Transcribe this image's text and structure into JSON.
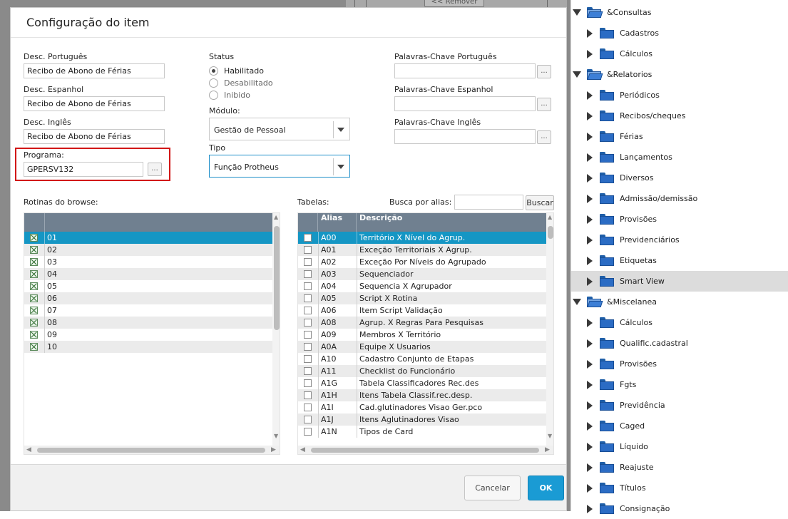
{
  "background": {
    "remover_label": "<< Remover"
  },
  "modal": {
    "title": "Configuração do item",
    "desc_pt_label": "Desc. Português",
    "desc_pt_value": "Recibo de Abono de Férias",
    "desc_es_label": "Desc. Espanhol",
    "desc_es_value": "Recibo de Abono de Férias",
    "desc_en_label": "Desc. Inglês",
    "desc_en_value": "Recibo de Abono de Férias",
    "programa_label": "Programa:",
    "programa_value": "GPERSV132",
    "dots": "...",
    "status_label": "Status",
    "status_options": [
      "Habilitado",
      "Desabilitado",
      "Inibido"
    ],
    "status_selected": "Habilitado",
    "modulo_label": "Módulo:",
    "modulo_value": "Gestão de Pessoal",
    "tipo_label": "Tipo",
    "tipo_value": "Função Protheus",
    "kw_pt_label": "Palavras-Chave Português",
    "kw_es_label": "Palavras-Chave Espanhol",
    "kw_en_label": "Palavras-Chave Inglês",
    "rotinas_label": "Rotinas do browse:",
    "tabelas_label": "Tabelas:",
    "busca_label": "Busca por alias:",
    "busca_value": "",
    "buscar_button": "Buscar",
    "cancel_button": "Cancelar",
    "ok_button": "OK"
  },
  "rotinas_grid": {
    "rows": [
      "01",
      "02",
      "03",
      "04",
      "05",
      "06",
      "07",
      "08",
      "09",
      "10"
    ]
  },
  "tabelas_grid": {
    "headers": [
      "Alias",
      "Descrição"
    ],
    "rows": [
      {
        "alias": "A00",
        "desc": "Território X Nível do Agrup."
      },
      {
        "alias": "A01",
        "desc": "Exceção Territoriais X Agrup."
      },
      {
        "alias": "A02",
        "desc": "Exceção Por Níveis do Agrupado"
      },
      {
        "alias": "A03",
        "desc": "Sequenciador"
      },
      {
        "alias": "A04",
        "desc": "Sequencia X Agrupador"
      },
      {
        "alias": "A05",
        "desc": "Script X Rotina"
      },
      {
        "alias": "A06",
        "desc": "Item Script Validação"
      },
      {
        "alias": "A08",
        "desc": "Agrup. X Regras Para Pesquisas"
      },
      {
        "alias": "A09",
        "desc": "Membros X Território"
      },
      {
        "alias": "A0A",
        "desc": "Equipe X Usuarios"
      },
      {
        "alias": "A10",
        "desc": "Cadastro Conjunto de Etapas"
      },
      {
        "alias": "A11",
        "desc": "Checklist do Funcionário"
      },
      {
        "alias": "A1G",
        "desc": "Tabela Classificadores Rec.des"
      },
      {
        "alias": "A1H",
        "desc": "Itens Tabela Classif.rec.desp."
      },
      {
        "alias": "A1I",
        "desc": "Cad.glutinadores Visao Ger.pco"
      },
      {
        "alias": "A1J",
        "desc": "Itens Aglutinadores Visao"
      },
      {
        "alias": "A1N",
        "desc": "Tipos de Card"
      }
    ]
  },
  "tree": {
    "items": [
      {
        "label": "&Consultas",
        "level": 0,
        "open": true
      },
      {
        "label": "Cadastros",
        "level": 1
      },
      {
        "label": "Cálculos",
        "level": 1
      },
      {
        "label": "&Relatorios",
        "level": 0,
        "open": true
      },
      {
        "label": "Periódicos",
        "level": 1
      },
      {
        "label": "Recibos/cheques",
        "level": 1
      },
      {
        "label": "Férias",
        "level": 1
      },
      {
        "label": "Lançamentos",
        "level": 1
      },
      {
        "label": "Diversos",
        "level": 1
      },
      {
        "label": "Admissão/demissão",
        "level": 1
      },
      {
        "label": "Provisões",
        "level": 1
      },
      {
        "label": "Previdenciários",
        "level": 1
      },
      {
        "label": "Etiquetas",
        "level": 1
      },
      {
        "label": "Smart View",
        "level": 1,
        "selected": true
      },
      {
        "label": "&Miscelanea",
        "level": 0,
        "open": true
      },
      {
        "label": "Cálculos",
        "level": 1
      },
      {
        "label": "Qualific.cadastral",
        "level": 1
      },
      {
        "label": "Provisões",
        "level": 1
      },
      {
        "label": "Fgts",
        "level": 1
      },
      {
        "label": "Previdência",
        "level": 1
      },
      {
        "label": "Caged",
        "level": 1
      },
      {
        "label": "Líquido",
        "level": 1
      },
      {
        "label": "Reajuste",
        "level": 1
      },
      {
        "label": "Títulos",
        "level": 1
      },
      {
        "label": "Consignação",
        "level": 1
      }
    ]
  },
  "colors": {
    "grid_header": "#708090",
    "selected_row": "#1596c4",
    "ok_button": "#1a9bd4",
    "highlight_border": "#d21717"
  }
}
